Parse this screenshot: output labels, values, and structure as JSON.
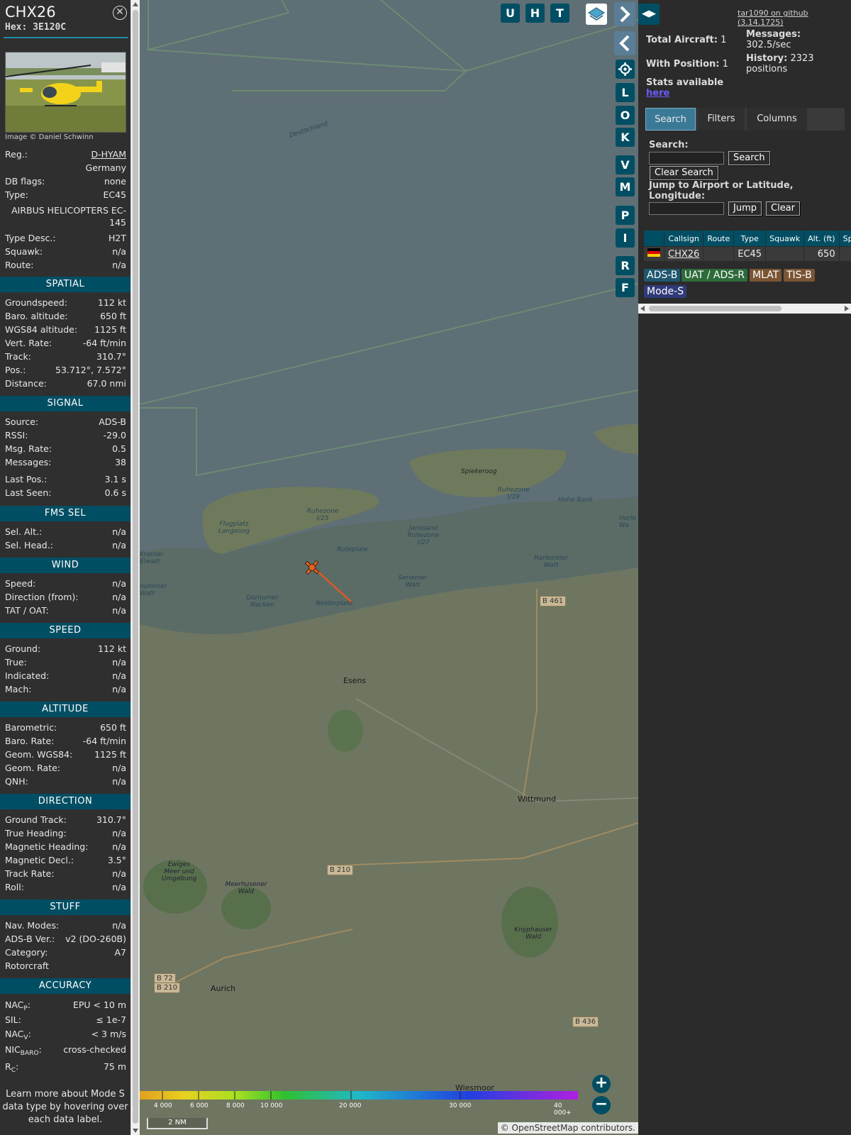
{
  "aircraft": {
    "callsign": "CHX26",
    "hex": "Hex: 3E120C",
    "photo_credit": "Image © Daniel Schwinn"
  },
  "info_rows": {
    "reg_label": "Reg.:",
    "reg_value": "D-HYAM",
    "country": "Germany",
    "dbflags_label": "DB flags:",
    "dbflags_value": "none",
    "type_label": "Type:",
    "type_value": "EC45",
    "type_full": "AIRBUS HELICOPTERS EC-145",
    "typedesc_label": "Type Desc.:",
    "typedesc_value": "H2T",
    "squawk_label": "Squawk:",
    "squawk_value": "n/a",
    "route_label": "Route:",
    "route_value": "n/a"
  },
  "sections": {
    "spatial": "SPATIAL",
    "signal": "SIGNAL",
    "fms": "FMS SEL",
    "wind": "WIND",
    "speed": "SPEED",
    "altitude": "ALTITUDE",
    "direction": "DIRECTION",
    "stuff": "STUFF",
    "accuracy": "ACCURACY"
  },
  "spatial": {
    "gs_label": "Groundspeed:",
    "gs_value": "112 kt",
    "baro_label": "Baro. altitude:",
    "baro_value": "650 ft",
    "wgs_label": "WGS84 altitude:",
    "wgs_value": "1125 ft",
    "vr_label": "Vert. Rate:",
    "vr_value": "-64 ft/min",
    "track_label": "Track:",
    "track_value": "310.7°",
    "pos_label": "Pos.:",
    "pos_value": "53.712°, 7.572°",
    "dist_label": "Distance:",
    "dist_value": "67.0 nmi"
  },
  "signal": {
    "src_label": "Source:",
    "src_value": "ADS-B",
    "rssi_label": "RSSI:",
    "rssi_value": "-29.0",
    "rate_label": "Msg. Rate:",
    "rate_value": "0.5",
    "msgs_label": "Messages:",
    "msgs_value": "38",
    "lastpos_label": "Last Pos.:",
    "lastpos_value": "3.1 s",
    "lastseen_label": "Last Seen:",
    "lastseen_value": "0.6 s"
  },
  "fms": {
    "alt_label": "Sel. Alt.:",
    "alt_value": "n/a",
    "head_label": "Sel. Head.:",
    "head_value": "n/a"
  },
  "wind": {
    "speed_label": "Speed:",
    "speed_value": "n/a",
    "dir_label": "Direction (from):",
    "dir_value": "n/a",
    "tat_label": "TAT / OAT:",
    "tat_value": "n/a"
  },
  "speed": {
    "ground_label": "Ground:",
    "ground_value": "112 kt",
    "true_label": "True:",
    "true_value": "n/a",
    "ind_label": "Indicated:",
    "ind_value": "n/a",
    "mach_label": "Mach:",
    "mach_value": "n/a"
  },
  "altitude": {
    "baro_label": "Barometric:",
    "baro_value": "650 ft",
    "rate_label": "Baro. Rate:",
    "rate_value": "-64 ft/min",
    "geom_label": "Geom. WGS84:",
    "geom_value": "1125 ft",
    "grate_label": "Geom. Rate:",
    "grate_value": "n/a",
    "qnh_label": "QNH:",
    "qnh_value": "n/a"
  },
  "direction": {
    "gt_label": "Ground Track:",
    "gt_value": "310.7°",
    "th_label": "True Heading:",
    "th_value": "n/a",
    "mh_label": "Magnetic Heading:",
    "mh_value": "n/a",
    "md_label": "Magnetic Decl.:",
    "md_value": "3.5°",
    "tr_label": "Track Rate:",
    "tr_value": "n/a",
    "roll_label": "Roll:",
    "roll_value": "n/a"
  },
  "stuff": {
    "nav_label": "Nav. Modes:",
    "nav_value": "n/a",
    "adsb_label": "ADS-B Ver.:",
    "adsb_value": "v2 (DO-260B)",
    "cat_label": "Category:",
    "cat_value": "A7",
    "cat_desc": "Rotorcraft"
  },
  "accuracy": {
    "nacp_label": "NAC",
    "nacp_sub": "P",
    "nacp_value": "EPU < 10 m",
    "sil_label": "SIL:",
    "sil_value": "≤ 1e-7",
    "nacv_label": "NAC",
    "nacv_sub": "V",
    "nacv_value": "< 3 m/s",
    "nic_label": "NIC",
    "nic_sub": "BARO",
    "nic_value": "cross-checked",
    "rc_label": "R",
    "rc_sub": "C",
    "rc_value": "75 m",
    "colon": ":"
  },
  "learn_more": "Learn more about Mode S data type by hovering over each data label.",
  "map": {
    "top_buttons": [
      "U",
      "H",
      "T"
    ],
    "side_buttons": [
      "L",
      "O",
      "K",
      "V",
      "M",
      "P",
      "I",
      "R",
      "F"
    ],
    "zoom_in": "+",
    "zoom_out": "−",
    "scale": "2 NM",
    "attribution": "© OpenStreetMap contributors.",
    "labels": {
      "deutschland": "Deutschland",
      "spiekeroog": "Spiekeroog",
      "ruhezone129": "Ruhezone I/29",
      "hoheBank": "Hohe Bank",
      "langeoog": "Flugplatz Langeoog",
      "ruhezone125": "Ruhezone I/25",
      "janssand": "Janssand Ruhezone I/27",
      "ruteplate": "Ruteplate",
      "harlesieler": "Harlesieler Watt",
      "dornumer": "Dornumer Nacken",
      "neiderplate": "Neiderplate",
      "seriemer": "Seriemer Watt",
      "esens": "Esens",
      "wittmund": "Wittmund",
      "ewiges": "Ewiges Meer und Umgebung",
      "meerhusener": "Meerhusener Wald",
      "knyphauser": "Knyphauser Wald",
      "aurich": "Aurich",
      "wiesmoor": "Wiesmoor",
      "b461": "B 461",
      "b210": "B 210",
      "b72": "B 72",
      "b210b": "B 210",
      "b436": "B 436",
      "kramer": "Kramer Elwatt",
      "nummer": "nummer Watt",
      "horle": "Horle Wa"
    },
    "altitude_ticks": [
      "4 000",
      "6 000",
      "8 000",
      "10 000",
      "20 000",
      "30 000",
      "40 000+"
    ]
  },
  "right": {
    "github": "tar1090 on github (3.14.1725)",
    "total_label": "Total Aircraft:",
    "total_value": "1",
    "messages_label": "Messages:",
    "messages_value": "302.5/sec",
    "withpos_label": "With Position:",
    "withpos_value": "1",
    "history_label": "History:",
    "history_value": "2323 positions",
    "stats_label": "Stats available",
    "here": "here",
    "tabs": [
      "Search",
      "Filters",
      "Columns"
    ],
    "search_label": "Search:",
    "search_button": "Search",
    "clear_search": "Clear Search",
    "jump_label": "Jump to Airport or Latitude, Longitude:",
    "jump_button": "Jump",
    "clear_button": "Clear",
    "table_headers": [
      "Callsign",
      "Route",
      "Type",
      "Squawk",
      "Alt. (ft)",
      "Spd."
    ],
    "table_row": {
      "callsign": "CHX26",
      "route": "",
      "type": "EC45",
      "squawk": "",
      "alt": "650",
      "spd": ""
    },
    "sources": [
      {
        "label": "ADS-B",
        "color": "#1f5670"
      },
      {
        "label": "UAT / ADS-R",
        "color": "#2e6b3a"
      },
      {
        "label": "MLAT",
        "color": "#7a5534"
      },
      {
        "label": "TIS-B",
        "color": "#7a5534"
      },
      {
        "label": "Mode-S",
        "color": "#2f3a78"
      }
    ]
  }
}
